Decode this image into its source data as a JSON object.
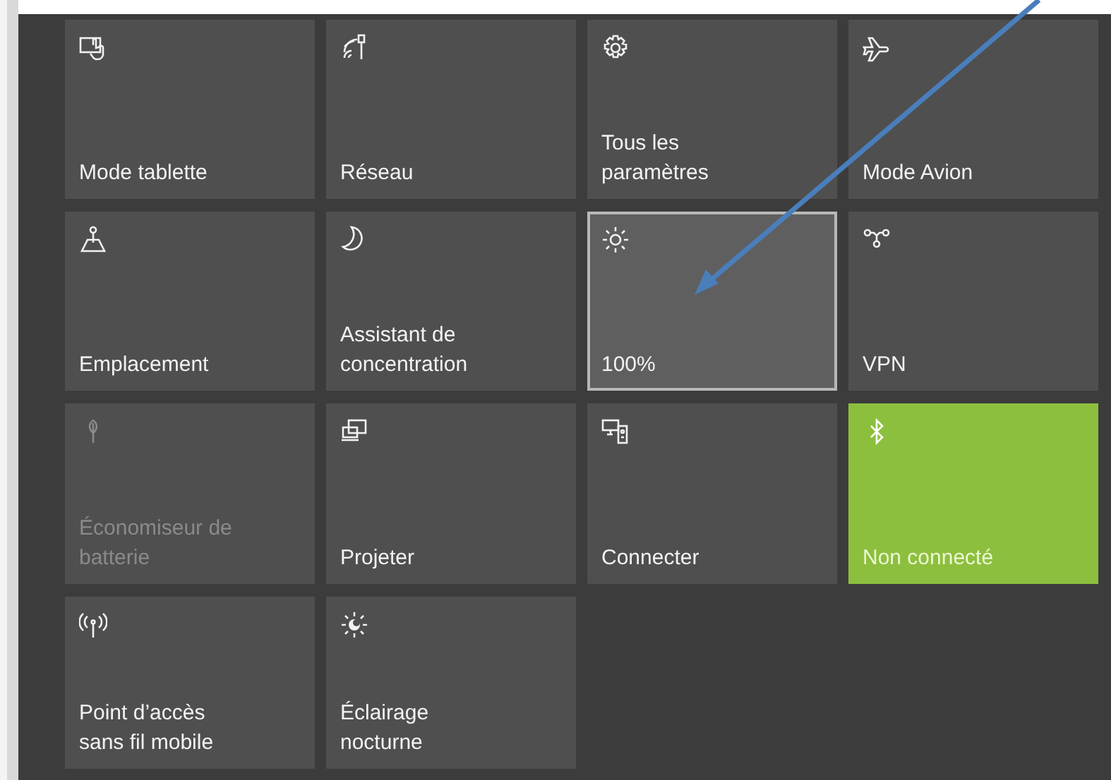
{
  "tiles": [
    {
      "label": "Mode tablette",
      "selected": false,
      "on": false,
      "disabled": false
    },
    {
      "label": "Réseau",
      "selected": false,
      "on": false,
      "disabled": false
    },
    {
      "label": "Tous les paramètres",
      "selected": false,
      "on": false,
      "disabled": false
    },
    {
      "label": "Mode Avion",
      "selected": false,
      "on": false,
      "disabled": false
    },
    {
      "label": "Emplacement",
      "selected": false,
      "on": false,
      "disabled": false
    },
    {
      "label": "Assistant de concentration",
      "selected": false,
      "on": false,
      "disabled": false
    },
    {
      "label": "100%",
      "selected": true,
      "on": false,
      "disabled": false
    },
    {
      "label": "VPN",
      "selected": false,
      "on": false,
      "disabled": false
    },
    {
      "label": "Économiseur de batterie",
      "selected": false,
      "on": false,
      "disabled": true
    },
    {
      "label": "Projeter",
      "selected": false,
      "on": false,
      "disabled": false
    },
    {
      "label": "Connecter",
      "selected": false,
      "on": false,
      "disabled": false
    },
    {
      "label": "Non connecté",
      "selected": false,
      "on": true,
      "disabled": false
    },
    {
      "label": "Point d’accès sans fil mobile",
      "selected": false,
      "on": false,
      "disabled": false
    },
    {
      "label": "Éclairage nocturne",
      "selected": false,
      "on": false,
      "disabled": false
    }
  ]
}
